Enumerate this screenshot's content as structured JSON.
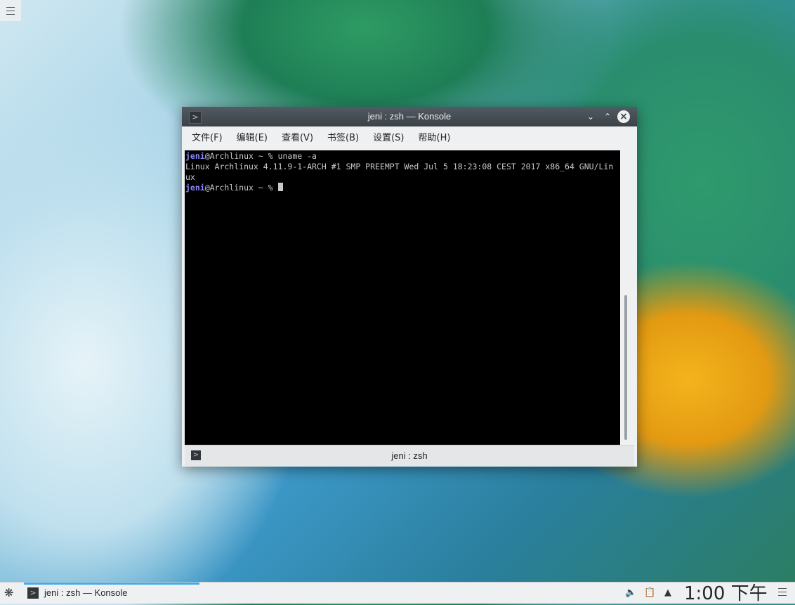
{
  "window": {
    "title": "jeni : zsh — Konsole",
    "menu": [
      "文件(F)",
      "编辑(E)",
      "查看(V)",
      "书签(B)",
      "设置(S)",
      "帮助(H)"
    ]
  },
  "terminal": {
    "line1": {
      "user": "jeni",
      "rest": "@Archlinux ~ % uname -a"
    },
    "line2": "Linux Archlinux 4.11.9-1-ARCH #1 SMP PREEMPT Wed Jul 5 18:23:08 CEST 2017 x86_64 GNU/Lin",
    "line3": "ux",
    "line4": {
      "user": "jeni",
      "rest": "@Archlinux ~ % "
    }
  },
  "tab": {
    "label": "jeni : zsh"
  },
  "panel": {
    "task_label": "jeni : zsh — Konsole",
    "clock": "1:00 下午"
  },
  "icons": {
    "terminal": "terminal-icon",
    "launcher": "launcher-icon",
    "volume": "volume-muted-icon",
    "clipboard": "clipboard-icon",
    "tray_expand": "chevron-up-icon",
    "panel_menu": "hamburger-icon"
  },
  "colors": {
    "accent": "#3daee9",
    "user_prompt": "#8b8bff"
  }
}
